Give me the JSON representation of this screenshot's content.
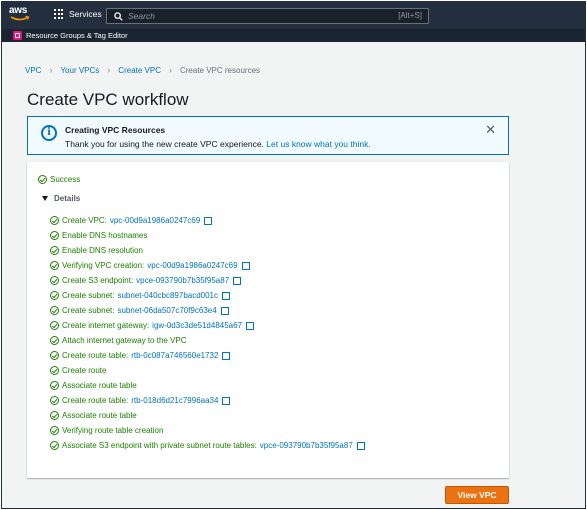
{
  "topbar": {
    "logo_text": "aws",
    "services_label": "Services",
    "search_placeholder": "Search",
    "search_shortcut": "[Alt+S]"
  },
  "subbar": {
    "label": "Resource Groups & Tag Editor",
    "icon_color": "#e7157b"
  },
  "breadcrumb": [
    "VPC",
    "Your VPCs",
    "Create VPC",
    "Create VPC resources"
  ],
  "page_title": "Create VPC workflow",
  "flash": {
    "title": "Creating VPC Resources",
    "message": "Thank you for using the new create VPC experience.",
    "link": "Let us know what you think.",
    "icon": "info-icon"
  },
  "status": "Success",
  "details_label": "Details",
  "steps": [
    {
      "text": "Create VPC:",
      "link": "vpc-00d9a1986a0247c69",
      "external": true
    },
    {
      "text": "Enable DNS hostnames",
      "link": "",
      "external": false
    },
    {
      "text": "Enable DNS resolution",
      "link": "",
      "external": false
    },
    {
      "text": "Verifying VPC creation:",
      "link": "vpc-00d9a1986a0247c69",
      "external": true
    },
    {
      "text": "Create S3 endpoint:",
      "link": "vpce-093790b7b35f95a87",
      "external": true
    },
    {
      "text": "Create subnet:",
      "link": "subnet-040cbc897bacd001c",
      "external": true
    },
    {
      "text": "Create subnet:",
      "link": "subnet-06da507c70f9c63e4",
      "external": true
    },
    {
      "text": "Create internet gateway:",
      "link": "igw-0d3c3de51d4845a67",
      "external": true
    },
    {
      "text": "Attach internet gateway to the VPC",
      "link": "",
      "external": false
    },
    {
      "text": "Create route table:",
      "link": "rtb-0c087a746560e1732",
      "external": true
    },
    {
      "text": "Create route",
      "link": "",
      "external": false
    },
    {
      "text": "Associate route table",
      "link": "",
      "external": false
    },
    {
      "text": "Create route table:",
      "link": "rtb-018d6d21c7996aa34",
      "external": true
    },
    {
      "text": "Associate route table",
      "link": "",
      "external": false
    },
    {
      "text": "Verifying route table creation",
      "link": "",
      "external": false
    },
    {
      "text": "Associate S3 endpoint with private subnet route tables:",
      "link": "vpce-093790b7b35f95a87",
      "external": true
    }
  ],
  "view_button": "View VPC",
  "colors": {
    "header_bg": "#232f3e",
    "success": "#1d8102",
    "link": "#0073bb",
    "primary_button": "#ec7211"
  }
}
